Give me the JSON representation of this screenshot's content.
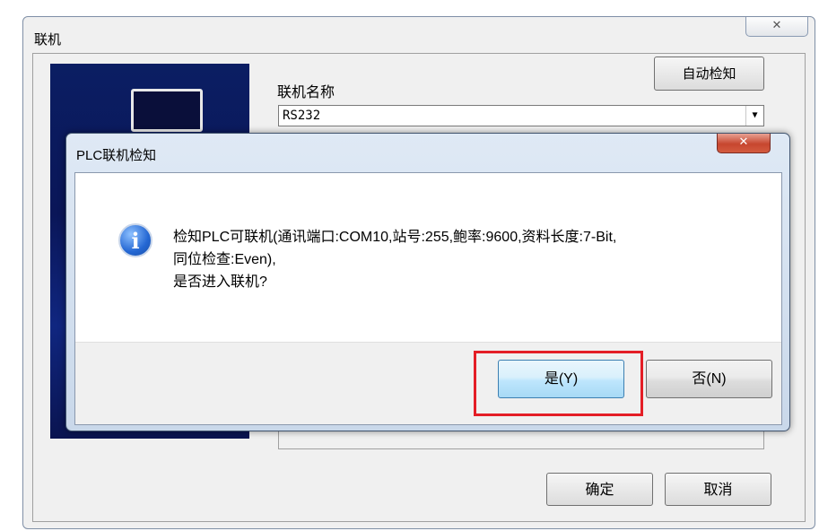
{
  "background_window": {
    "title": "联机",
    "close_glyph": "✕",
    "auto_detect_label": "自动检知",
    "connection_label": "联机名称",
    "connection_value": "RS232",
    "dropdown_glyph": "▼",
    "ok_label": "确定",
    "cancel_label": "取消"
  },
  "dialog": {
    "title": "PLC联机检知",
    "close_glyph": "✕",
    "icon": "info-icon",
    "icon_glyph": "i",
    "message_lines": [
      "检知PLC可联机(通讯端口:COM10,站号:255,鲍率:9600,资料长度:7-Bit,",
      "同位检查:Even),",
      "是否进入联机?"
    ],
    "yes_label": "是(Y)",
    "no_label": "否(N)"
  },
  "colors": {
    "highlight": "#e41e26",
    "dialog_frame": "#c9d8ea",
    "close_red": "#c7462f"
  }
}
